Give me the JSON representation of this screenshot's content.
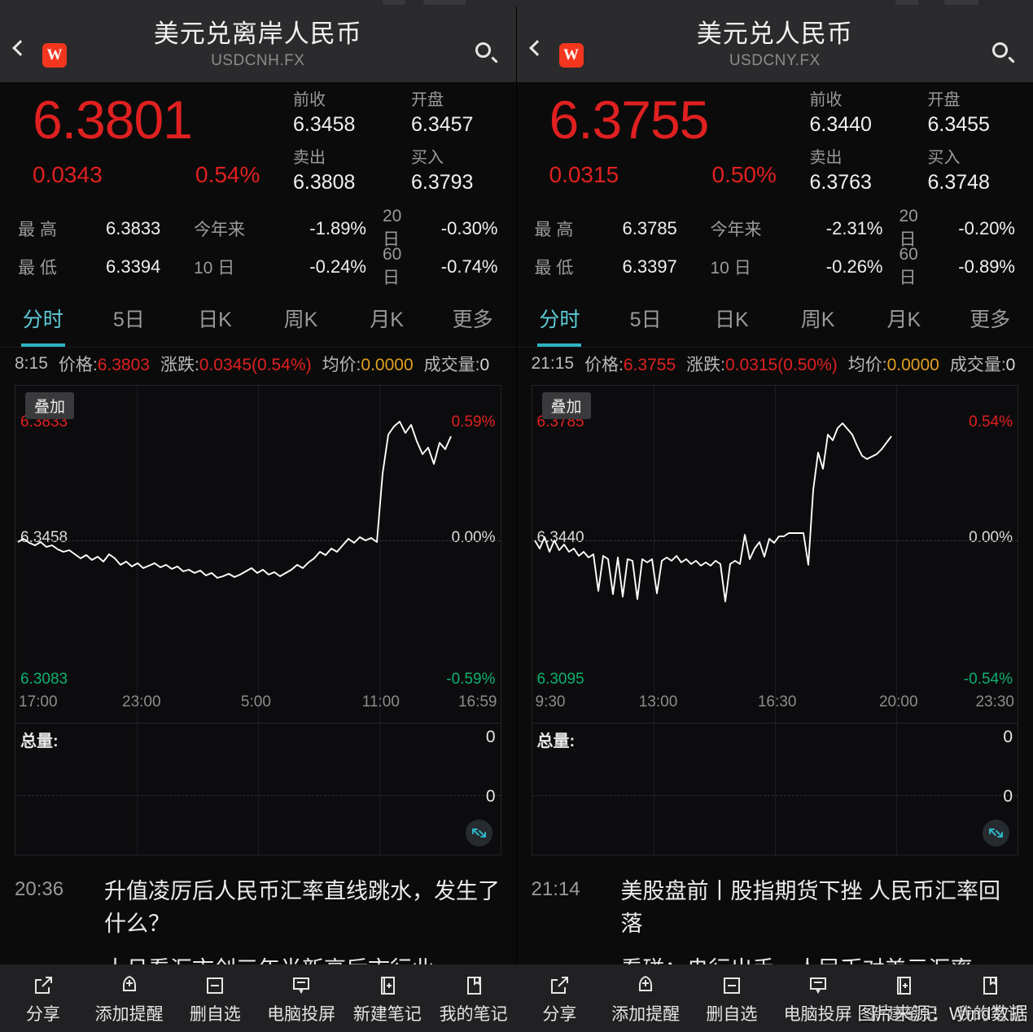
{
  "panels": [
    {
      "id": "usdcnh",
      "nav": {
        "back_icon": "chevron-left-icon",
        "logo": "W",
        "title": "美元兑离岸人民币",
        "code": "USDCNH.FX",
        "search_icon": "search-icon"
      },
      "quote": {
        "price": "6.3801",
        "change_abs": "0.0343",
        "change_pct": "0.54%",
        "prev_close_label": "前收",
        "prev_close": "6.3458",
        "open_label": "开盘",
        "open": "6.3457",
        "sell_label": "卖出",
        "sell": "6.3808",
        "buy_label": "买入",
        "buy": "6.3793"
      },
      "stats": {
        "high_label": "最  高",
        "high": "6.3833",
        "low_label": "最  低",
        "low": "6.3394",
        "ytd_label": "今年来",
        "ytd": "-1.89%",
        "d20_label": "20  日",
        "d20": "-0.30%",
        "d10_label": "10  日",
        "d10": "-0.24%",
        "d60_label": "60  日",
        "d60": "-0.74%"
      },
      "tabs": [
        {
          "label": "分时",
          "active": true
        },
        {
          "label": "5日",
          "active": false
        },
        {
          "label": "日K",
          "active": false
        },
        {
          "label": "周K",
          "active": false
        },
        {
          "label": "月K",
          "active": false
        },
        {
          "label": "更多",
          "active": false
        }
      ],
      "readout": {
        "time": "8:15",
        "price_label": "价格:",
        "price": "6.3803",
        "chg_label": "涨跌:",
        "chg": "0.0345(0.54%)",
        "avg_label": "均价:",
        "avg": "0.0000",
        "vol_label": "成交量:",
        "vol": "0"
      },
      "chart": {
        "overlay_button": "叠加",
        "high_price": "6.3833",
        "high_pct": "0.59%",
        "mid_price": "6.3458",
        "mid_pct": "0.00%",
        "low_price": "6.3083",
        "low_pct": "-0.59%",
        "xticks": [
          "17:00",
          "23:00",
          "5:00",
          "11:00",
          "16:59"
        ],
        "volume_label": "总量:",
        "volume_top": "0",
        "volume_mid": "0",
        "expand_icon": "expand-icon"
      },
      "news": [
        {
          "time": "20:36",
          "title": "升值凌厉后人民币汇率直线跳水，发生了什么？"
        },
        {
          "time": "",
          "title": "十月看汇市创三年半新高后市行业"
        }
      ],
      "toolbar": [
        {
          "icon": "share-icon",
          "label": "分享"
        },
        {
          "icon": "bell-add-icon",
          "label": "添加提醒"
        },
        {
          "icon": "minus-box-icon",
          "label": "删自选"
        },
        {
          "icon": "cast-screen-icon",
          "label": "电脑投屏"
        },
        {
          "icon": "note-add-icon",
          "label": "新建笔记"
        },
        {
          "icon": "bookmark-icon",
          "label": "我的笔记"
        }
      ]
    },
    {
      "id": "usdcny",
      "nav": {
        "back_icon": "chevron-left-icon",
        "logo": "W",
        "title": "美元兑人民币",
        "code": "USDCNY.FX",
        "search_icon": "search-icon"
      },
      "quote": {
        "price": "6.3755",
        "change_abs": "0.0315",
        "change_pct": "0.50%",
        "prev_close_label": "前收",
        "prev_close": "6.3440",
        "open_label": "开盘",
        "open": "6.3455",
        "sell_label": "卖出",
        "sell": "6.3763",
        "buy_label": "买入",
        "buy": "6.3748"
      },
      "stats": {
        "high_label": "最  高",
        "high": "6.3785",
        "low_label": "最  低",
        "low": "6.3397",
        "ytd_label": "今年来",
        "ytd": "-2.31%",
        "d20_label": "20  日",
        "d20": "-0.20%",
        "d10_label": "10  日",
        "d10": "-0.26%",
        "d60_label": "60  日",
        "d60": "-0.89%"
      },
      "tabs": [
        {
          "label": "分时",
          "active": true
        },
        {
          "label": "5日",
          "active": false
        },
        {
          "label": "日K",
          "active": false
        },
        {
          "label": "周K",
          "active": false
        },
        {
          "label": "月K",
          "active": false
        },
        {
          "label": "更多",
          "active": false
        }
      ],
      "readout": {
        "time": "21:15",
        "price_label": "价格:",
        "price": "6.3755",
        "chg_label": "涨跌:",
        "chg": "0.0315(0.50%)",
        "avg_label": "均价:",
        "avg": "0.0000",
        "vol_label": "成交量:",
        "vol": "0"
      },
      "chart": {
        "overlay_button": "叠加",
        "high_price": "6.3785",
        "high_pct": "0.54%",
        "mid_price": "6.3440",
        "mid_pct": "0.00%",
        "low_price": "6.3095",
        "low_pct": "-0.54%",
        "xticks": [
          "9:30",
          "13:00",
          "16:30",
          "20:00",
          "23:30"
        ],
        "volume_label": "总量:",
        "volume_top": "0",
        "volume_mid": "0",
        "expand_icon": "expand-icon"
      },
      "news": [
        {
          "time": "21:14",
          "title": "美股盘前丨股指期货下挫 人民币汇率回落"
        },
        {
          "time": "",
          "title": "看碰：央行出手，人民币对美元汇率"
        }
      ],
      "toolbar": [
        {
          "icon": "share-icon",
          "label": "分享"
        },
        {
          "icon": "bell-add-icon",
          "label": "添加提醒"
        },
        {
          "icon": "minus-box-icon",
          "label": "删自选"
        },
        {
          "icon": "cast-screen-icon",
          "label": "电脑投屏"
        },
        {
          "icon": "note-add-icon",
          "label": "新建笔记"
        },
        {
          "icon": "bookmark-icon",
          "label": "我的笔记"
        }
      ]
    }
  ],
  "watermark": "图片来源：Wind数据",
  "colors": {
    "up_red": "#e02020",
    "down_green": "#10b070",
    "accent_cyan": "#5ecbd8",
    "brand_red": "#f5361e"
  },
  "chart_data": [
    {
      "type": "line",
      "title": "美元兑离岸人民币 USDCNH.FX 分时",
      "xlabel": "",
      "ylabel": "",
      "grid": true,
      "legend": "none",
      "xticks": [
        "17:00",
        "23:00",
        "5:00",
        "11:00",
        "16:59"
      ],
      "ylim": [
        6.3083,
        6.3833
      ],
      "y_right_lim": [
        "-0.59%",
        "0.59%"
      ],
      "baseline": 6.3458,
      "series": [
        {
          "name": "USDCNH",
          "x": [
            0,
            1,
            2,
            3,
            4,
            5,
            6,
            7,
            8,
            9,
            10,
            11,
            12,
            13,
            14,
            15,
            16,
            17,
            18,
            19,
            20,
            21,
            22,
            23,
            24,
            25,
            26,
            27,
            28,
            29,
            30,
            31,
            32,
            33,
            34,
            35,
            36,
            37,
            38,
            39,
            40,
            41,
            42,
            43,
            44,
            45,
            46,
            47,
            48,
            49,
            50,
            51,
            52,
            53,
            54,
            55,
            56,
            57,
            58,
            59,
            60,
            61,
            62,
            63,
            64,
            65,
            66,
            67,
            68,
            69,
            70,
            71,
            72,
            73,
            74,
            75,
            76,
            77,
            78,
            79,
            80
          ],
          "values": [
            6.3458,
            6.3462,
            6.3455,
            6.3452,
            6.3456,
            6.345,
            6.3452,
            6.3447,
            6.3444,
            6.3446,
            6.3441,
            6.3436,
            6.344,
            6.3434,
            6.3438,
            6.3432,
            6.3441,
            6.3436,
            6.3428,
            6.3432,
            6.3426,
            6.343,
            6.3424,
            6.3427,
            6.343,
            6.3425,
            6.3428,
            6.3423,
            6.3426,
            6.342,
            6.3422,
            6.3418,
            6.3421,
            6.3415,
            6.3418,
            6.3412,
            6.3414,
            6.3417,
            6.3413,
            6.3416,
            6.342,
            6.3424,
            6.3418,
            6.3422,
            6.3416,
            6.3419,
            6.3414,
            6.3418,
            6.3422,
            6.3428,
            6.3424,
            6.3431,
            6.3436,
            6.3444,
            6.344,
            6.3448,
            6.3444,
            6.3452,
            6.346,
            6.3455,
            6.3462,
            6.3458,
            6.3461,
            6.3456,
            6.354,
            6.361,
            6.366,
            6.37,
            6.374,
            6.3775,
            6.38,
            6.3833,
            6.38,
            6.382,
            6.378,
            6.3752,
            6.3742,
            6.3775,
            6.376,
            6.379,
            6.3803
          ]
        }
      ],
      "volume": {
        "label": "总量:",
        "total": 0,
        "values": []
      }
    },
    {
      "type": "line",
      "title": "美元兑人民币 USDCNY.FX 分时",
      "xlabel": "",
      "ylabel": "",
      "grid": true,
      "legend": "none",
      "xticks": [
        "9:30",
        "13:00",
        "16:30",
        "20:00",
        "23:30"
      ],
      "ylim": [
        6.3095,
        6.3785
      ],
      "y_right_lim": [
        "-0.54%",
        "0.54%"
      ],
      "baseline": 6.344,
      "series": [
        {
          "name": "USDCNY",
          "x": [
            0,
            1,
            2,
            3,
            4,
            5,
            6,
            7,
            8,
            9,
            10,
            11,
            12,
            13,
            14,
            15,
            16,
            17,
            18,
            19,
            20,
            21,
            22,
            23,
            24,
            25,
            26,
            27,
            28,
            29,
            30,
            31,
            32,
            33,
            34,
            35,
            36,
            37,
            38,
            39,
            40,
            41,
            42,
            43,
            44,
            45,
            46,
            47,
            48,
            49,
            50,
            51,
            52,
            53,
            54,
            55,
            56,
            57,
            58,
            59,
            60,
            61,
            62,
            63,
            64,
            65,
            66,
            67,
            68,
            69,
            70,
            71,
            72,
            73,
            74,
            75,
            76,
            77,
            78,
            79
          ],
          "values": [
            6.344,
            6.3432,
            6.3444,
            6.3428,
            6.344,
            6.343,
            6.3436,
            6.3428,
            6.3432,
            6.3424,
            6.3428,
            6.3422,
            6.3426,
            6.339,
            6.3424,
            6.342,
            6.3386,
            6.3422,
            6.3384,
            6.342,
            6.3418,
            6.338,
            6.342,
            6.3416,
            6.342,
            6.3386,
            6.3418,
            6.3422,
            6.3418,
            6.3424,
            6.3416,
            6.342,
            6.3414,
            6.3418,
            6.3412,
            6.3416,
            6.3412,
            6.3418,
            6.3414,
            6.337,
            6.3416,
            6.342,
            6.3416,
            6.345,
            6.3424,
            6.3436,
            6.3444,
            6.3428,
            6.3448,
            6.3444,
            6.3452,
            6.3452,
            6.3456,
            6.3456,
            6.3456,
            6.3456,
            6.342,
            6.35,
            6.356,
            6.353,
            6.36,
            6.359,
            6.364,
            6.366,
            6.365,
            6.37,
            6.372,
            6.375,
            6.377,
            6.3785,
            6.3775,
            6.3765,
            6.374,
            6.3725,
            6.372,
            6.3722,
            6.3735,
            6.3745,
            6.375,
            6.3755
          ]
        }
      ],
      "volume": {
        "label": "总量:",
        "total": 0,
        "values": []
      }
    }
  ]
}
